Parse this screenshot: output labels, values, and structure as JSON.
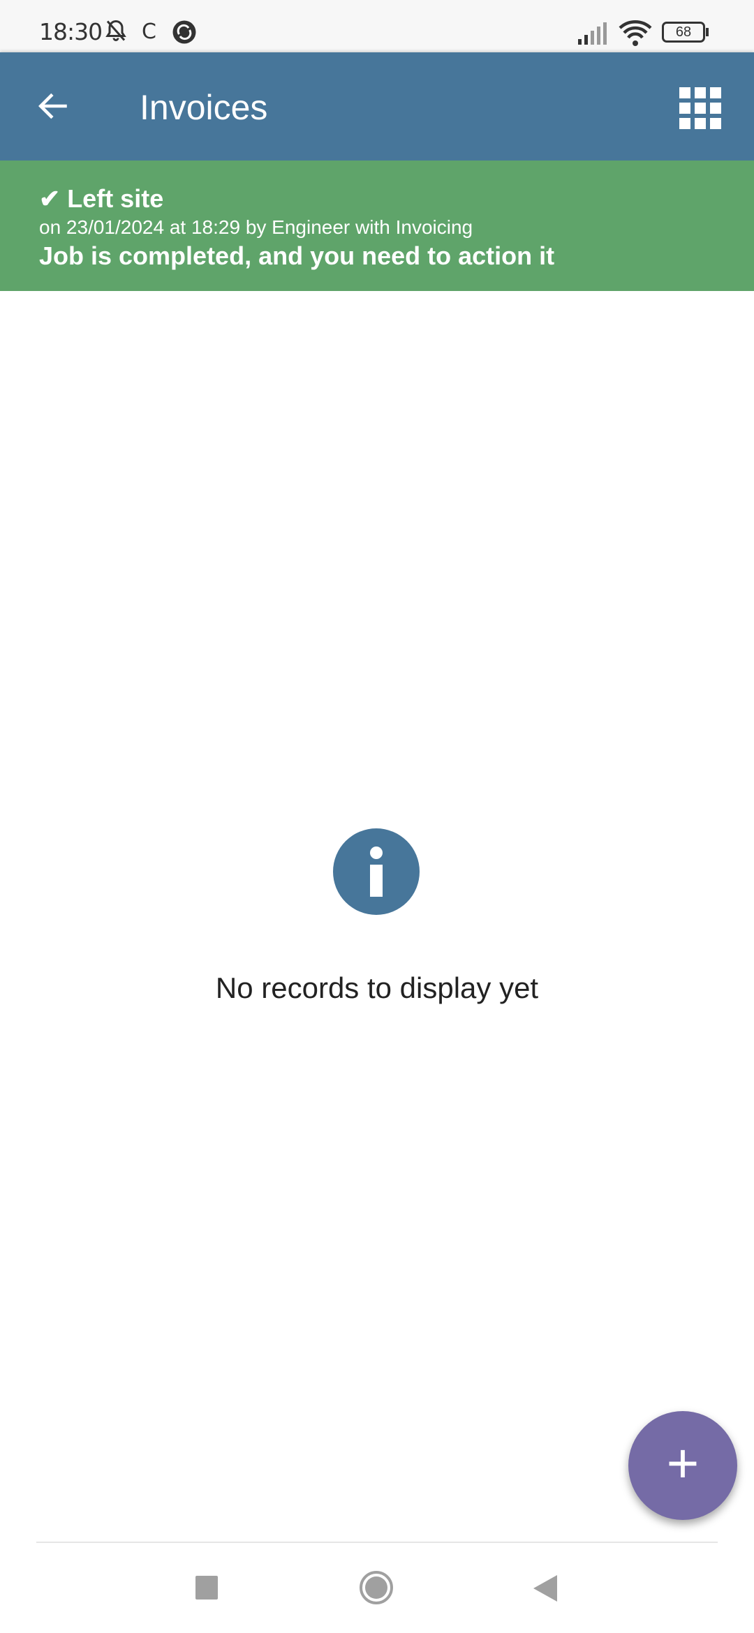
{
  "status_bar": {
    "time": "18:30",
    "carrier_letter": "C",
    "battery": "68",
    "icons": [
      "bell-off-icon",
      "app-icon",
      "signal-icon",
      "wifi-icon",
      "battery-icon"
    ]
  },
  "app_bar": {
    "title": "Invoices",
    "back_icon": "arrow-left-icon",
    "menu_icon": "grid-icon",
    "color": "#47769a"
  },
  "banner": {
    "status": "Left site",
    "detail": "on 23/01/2024 at 18:29 by Engineer with Invoicing",
    "message": "Job is completed, and you need to action it",
    "color": "#5fa46a"
  },
  "empty_state": {
    "icon": "info-icon",
    "text": "No records to display yet"
  },
  "fab": {
    "label": "+",
    "color": "#756ba6"
  },
  "nav_bar": {
    "items": [
      "recents-button",
      "home-button",
      "back-button"
    ]
  }
}
